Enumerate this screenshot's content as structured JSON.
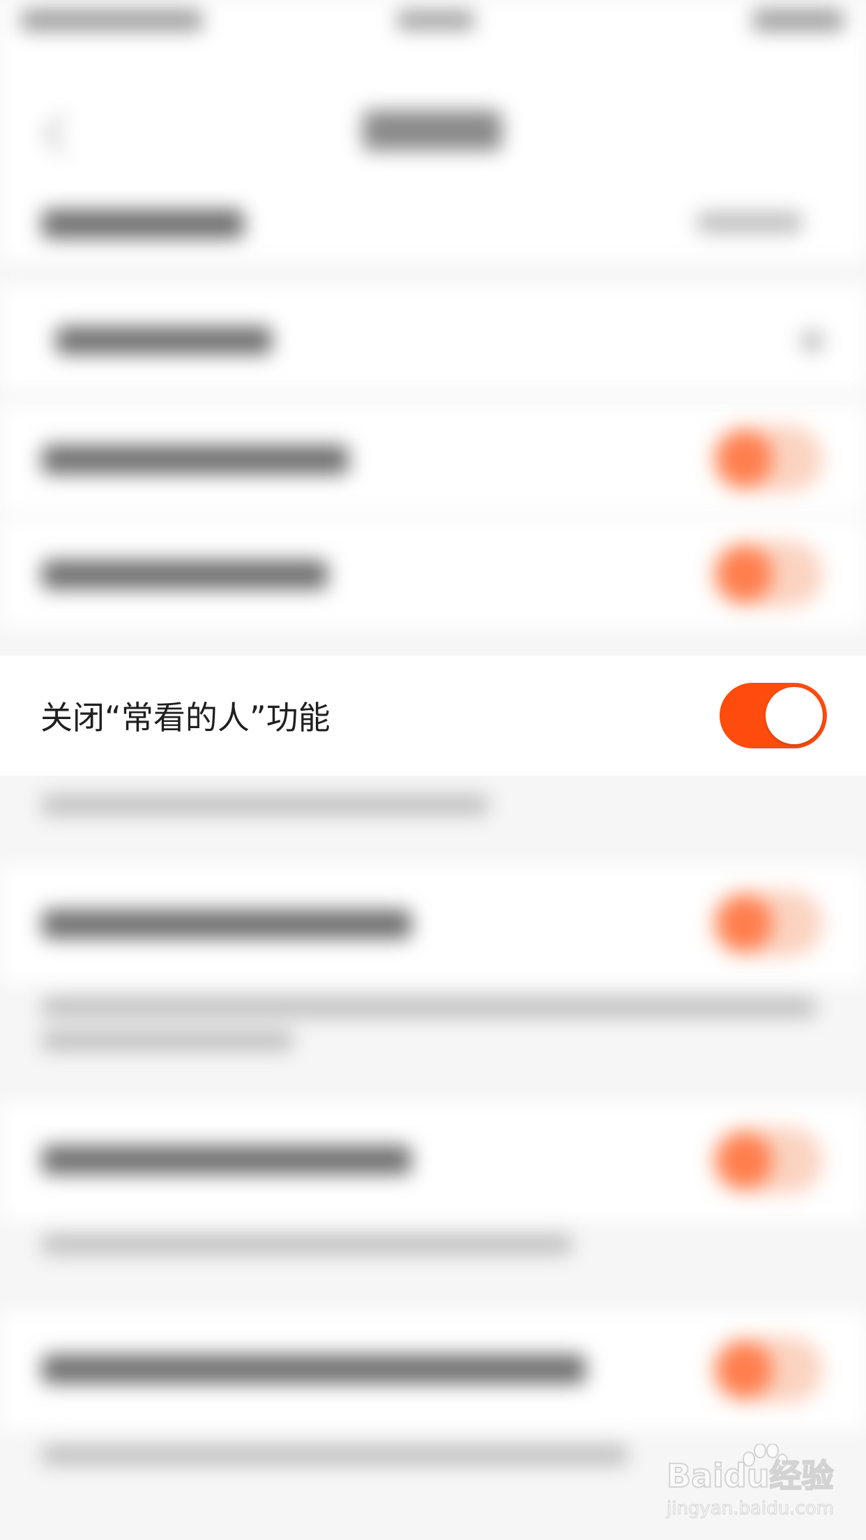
{
  "focused_setting": {
    "label": "关闭“常看的人”功能",
    "toggle_state": "on",
    "toggle_color": "#fe4b0e"
  },
  "watermark": {
    "brand": "Baidu经验",
    "url": "jingyan.baidu.com"
  }
}
